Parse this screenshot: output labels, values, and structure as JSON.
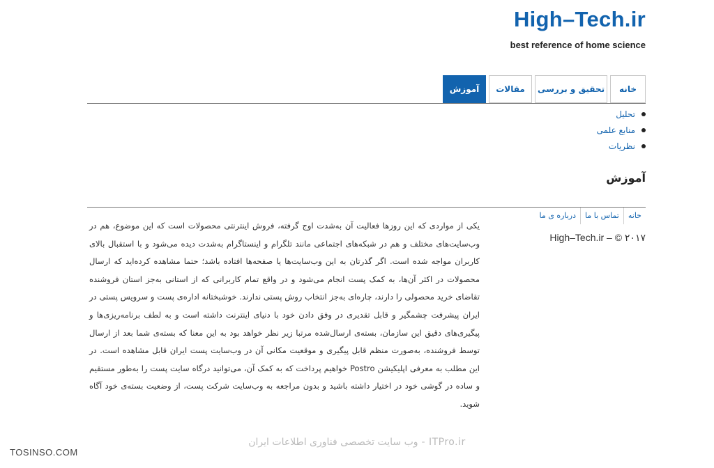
{
  "header": {
    "site_title": "High–Tech.ir",
    "site_description": "best reference of home science"
  },
  "tabs": [
    {
      "label": "خانه",
      "active": false
    },
    {
      "label": "تحقیق و بررسی",
      "active": false
    },
    {
      "label": "مقالات",
      "active": false
    },
    {
      "label": "آموزش",
      "active": true
    }
  ],
  "subnav": [
    {
      "label": "تحلیل"
    },
    {
      "label": "منابع علمی"
    },
    {
      "label": "نظریات"
    }
  ],
  "page": {
    "heading": "آموزش",
    "article_text": "یکی از مواردی که این روزها فعالیت آن به‌شدت اوج گرفته، فروش اینترنتی محصولات است که این موضوع، هم در وب‌سایت‌های مختلف و هم در شبکه‌های اجتماعی مانند تلگرام و اینستاگرام به‌شدت دیده می‌شود و با استقبال بالای کاربران مواجه شده است. اگر گذرتان به این وب‌سایت‌ها یا صفحه‌ها افتاده باشد؛ حتما مشاهده کرده‌اید که ارسال محصولات در اکثر آن‌ها، به کمک پست انجام می‌شود و در واقع تمام کاربرانی که از استانی به‌جز استان فروشنده تقاضای خرید محصولی را دارند، چاره‌ای به‌جز انتخاب روش پستی ندارند. خوشبختانه اداره‌ی پست و سرویس پستی در ایران پیشرفت چشمگیر و قابل تقدیری در وفق دادن خود با دنیای اینترنت داشته است و به لطف برنامه‌ریزی‌ها و پیگیری‌های دقیق این سازمان، بسته‌ی ارسال‌شده مرتبا زیر نظر خواهد بود به این معنا که بسته‌ی شما بعد از ارسال توسط فروشنده، به‌صورت منظم قابل پیگیری و موقعیت مکانی آن در وب‌سایت پست ایران قابل مشاهده است. در این مطلب به معرفی اپلیکیشن Postro خواهیم پرداخت که به کمک آن، می‌توانید درگاه سایت پست را به‌طور مستقیم و ساده در گوشی خود در اختیار داشته باشید و بدون مراجعه به وب‌سایت شرکت پست، از وضعیت بسته‌ی خود آگاه شوید."
  },
  "footer": {
    "links": [
      {
        "label": "خانه"
      },
      {
        "label": "تماس با ما"
      },
      {
        "label": "درباره ی ما"
      }
    ],
    "copyright": "High–Tech.ir – © ۲۰۱۷"
  },
  "watermarks": {
    "left": "TOSINSO.COM",
    "center": "ITPro.ir - وب سایت تخصصی فناوری اطلاعات ایران"
  },
  "colors": {
    "accent": "#1263ae",
    "text": "#222222",
    "rule": "#777777"
  }
}
